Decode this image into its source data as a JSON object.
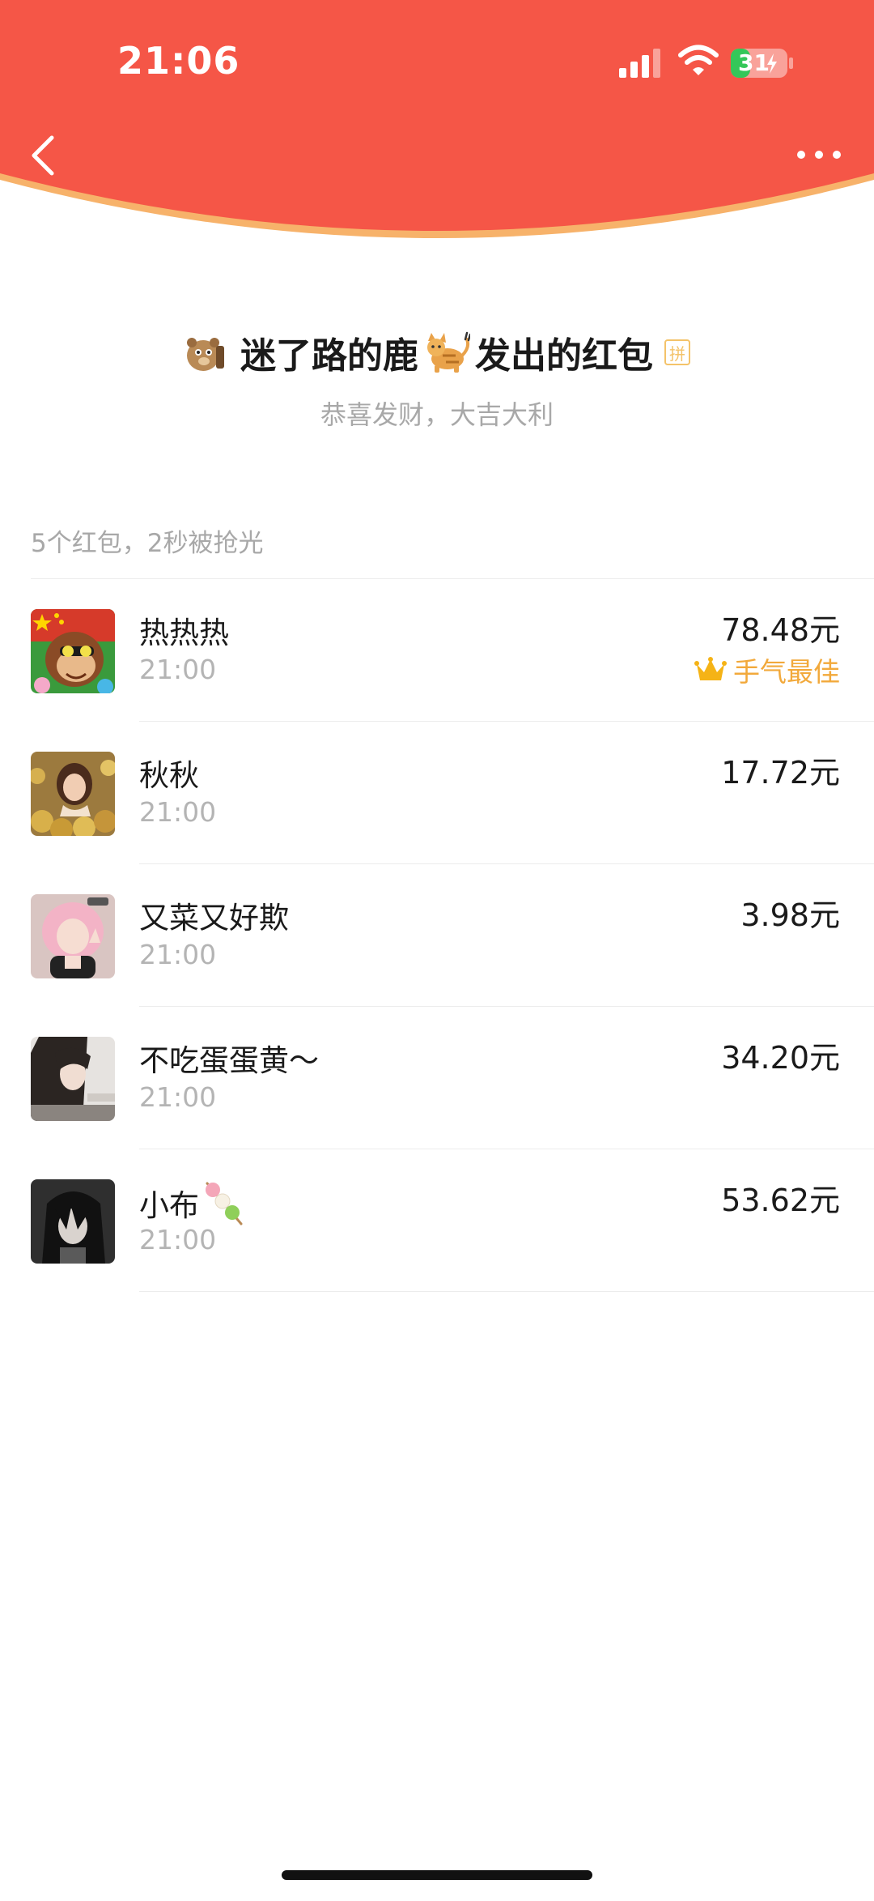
{
  "status_bar": {
    "time": "21:06",
    "battery": "31"
  },
  "colors": {
    "header_red": "#f55647",
    "header_rim": "#f7b26a",
    "best_gold": "#f2a93b"
  },
  "nav": {
    "back_icon": "chevron-left-icon",
    "more_icon": "more-dots-icon"
  },
  "sender": {
    "name": "迷了路的鹿",
    "suffix": "发出的红包",
    "pin_badge": "拼",
    "wish": "恭喜发财，大吉大利"
  },
  "summary": "5个红包，2秒被抢光",
  "records": [
    {
      "name": "热热热",
      "time": "21:00",
      "amount": "78.48元",
      "best": "手气最佳"
    },
    {
      "name": "秋秋",
      "time": "21:00",
      "amount": "17.72元"
    },
    {
      "name": "又菜又好欺",
      "time": "21:00",
      "amount": "3.98元"
    },
    {
      "name": "不吃蛋蛋黄～",
      "time": "21:00",
      "amount": "34.20元"
    },
    {
      "name": "小布",
      "time": "21:00",
      "amount": "53.62元"
    }
  ]
}
